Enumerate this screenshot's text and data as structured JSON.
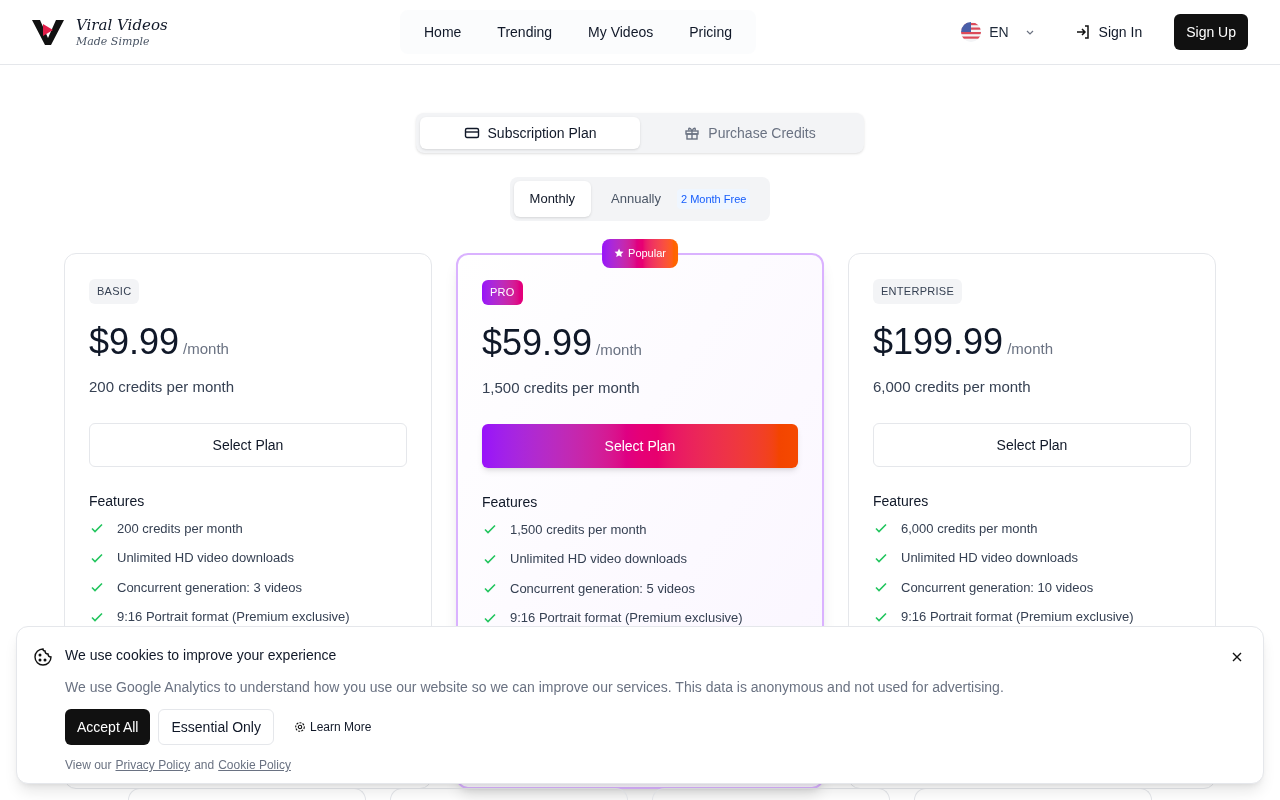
{
  "brand": {
    "name": "Viral Videos",
    "tagline": "Made Simple"
  },
  "nav": [
    {
      "label": "Home"
    },
    {
      "label": "Trending"
    },
    {
      "label": "My Videos"
    },
    {
      "label": "Pricing"
    }
  ],
  "language": {
    "code": "EN"
  },
  "auth": {
    "sign_in": "Sign In",
    "sign_up": "Sign Up"
  },
  "plan_tabs": [
    {
      "label": "Subscription Plan",
      "kind": "card",
      "selected": true
    },
    {
      "label": "Purchase Credits",
      "kind": "gift",
      "selected": false
    }
  ],
  "billing": [
    {
      "label": "Monthly",
      "selected": true
    },
    {
      "label": "Annually",
      "badge": "2 Month Free",
      "selected": false
    }
  ],
  "plans": [
    {
      "tier": "BASIC",
      "featured": false,
      "price": "$9.99",
      "period": "/month",
      "credits": "200 credits per month",
      "button": "Select Plan",
      "features_title": "Features",
      "features": [
        "200 credits per month",
        "Unlimited HD video downloads",
        "Concurrent generation: 3 videos",
        "9:16 Portrait format (Premium exclusive)"
      ]
    },
    {
      "tier": "PRO",
      "featured": true,
      "ribbon": "Popular",
      "price": "$59.99",
      "period": "/month",
      "credits": "1,500 credits per month",
      "button": "Select Plan",
      "features_title": "Features",
      "features": [
        "1,500 credits per month",
        "Unlimited HD video downloads",
        "Concurrent generation: 5 videos",
        "9:16 Portrait format (Premium exclusive)"
      ]
    },
    {
      "tier": "ENTERPRISE",
      "featured": false,
      "price": "$199.99",
      "period": "/month",
      "credits": "6,000 credits per month",
      "button": "Select Plan",
      "features_title": "Features",
      "features": [
        "6,000 credits per month",
        "Unlimited HD video downloads",
        "Concurrent generation: 10 videos",
        "9:16 Portrait format (Premium exclusive)"
      ]
    }
  ],
  "cookie_banner": {
    "title": "We use cookies to improve your experience",
    "text": "We use Google Analytics to understand how you use our website so we can improve our services. This data is anonymous and not used for advertising.",
    "accept": "Accept All",
    "essential": "Essential Only",
    "learn_more": "Learn More",
    "footer_prefix": "View our",
    "privacy_link": "Privacy Policy",
    "footer_and": "and",
    "cookie_link": "Cookie Policy"
  }
}
